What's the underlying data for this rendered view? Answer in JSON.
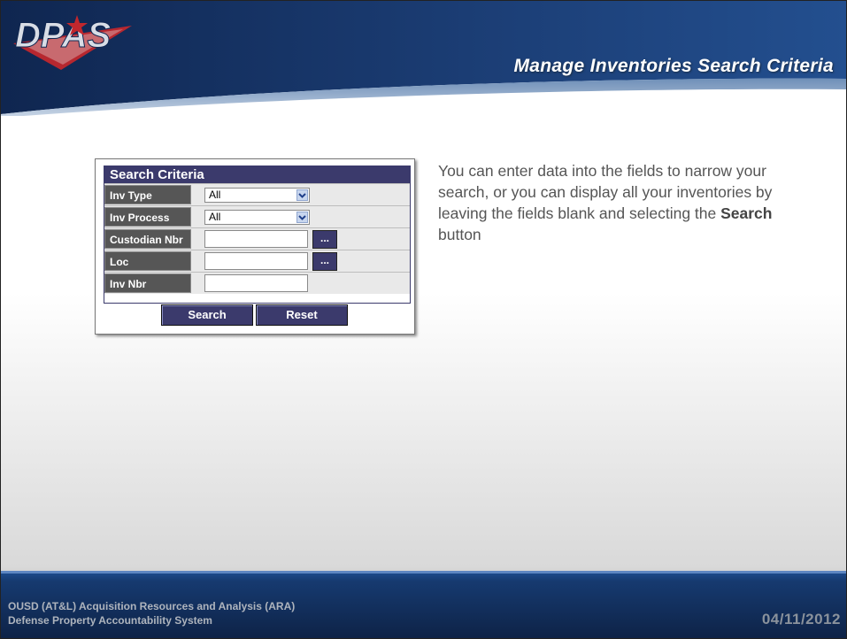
{
  "header": {
    "logo_text": "DPAS",
    "title": "Manage Inventories Search Criteria"
  },
  "search_panel": {
    "title": "Search Criteria",
    "rows": [
      {
        "label": "Inv Type",
        "value": "All",
        "kind": "select"
      },
      {
        "label": "Inv Process",
        "value": "All",
        "kind": "select"
      },
      {
        "label": "Custodian Nbr",
        "value": "",
        "kind": "text-lookup"
      },
      {
        "label": "Loc",
        "value": "",
        "kind": "text-lookup"
      },
      {
        "label": "Inv Nbr",
        "value": "",
        "kind": "text"
      }
    ],
    "lookup_label": "...",
    "search_button": "Search",
    "reset_button": "Reset"
  },
  "description": {
    "part1": "You can enter data into the fields to narrow your search, or you can display all your inventories by leaving the fields blank and selecting the ",
    "bold": "Search",
    "part2": " button"
  },
  "footer": {
    "line1": "OUSD (AT&L) Acquisition Resources and Analysis (ARA)",
    "line2": "Defense Property Accountability System",
    "date": "04/11/2012"
  },
  "colors": {
    "header_blue": "#1b3d74",
    "panel_navy": "#3b3a6c",
    "label_gray": "#565656",
    "logo_red": "#c1272d"
  }
}
